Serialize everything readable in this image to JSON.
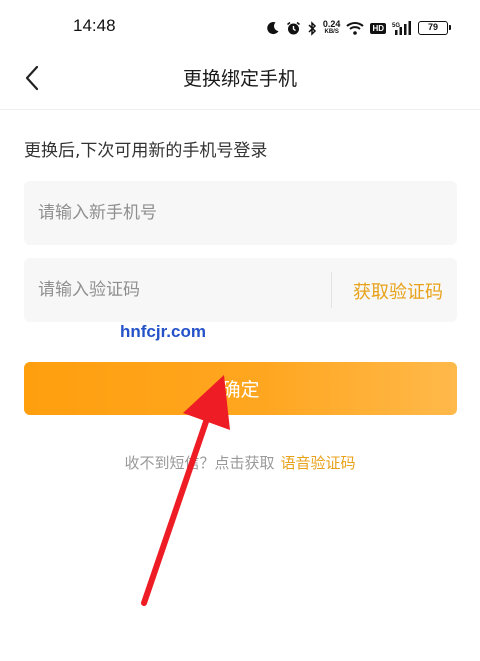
{
  "status_bar": {
    "time": "14:48",
    "net_speed_value": "0.24",
    "net_speed_unit": "KB/S",
    "hd_label": "HD",
    "signal_label": "5G",
    "battery_level": "79"
  },
  "nav": {
    "title": "更换绑定手机"
  },
  "hint": "更换后,下次可用新的手机号登录",
  "phone_input": {
    "placeholder": "请输入新手机号",
    "value": ""
  },
  "code_input": {
    "placeholder": "请输入验证码",
    "value": "",
    "get_code_label": "获取验证码"
  },
  "watermark": "hnfcjr.com",
  "confirm_button": {
    "label": "确定"
  },
  "footer": {
    "prompt": "收不到短信？点击获取",
    "voice_code_link": "语音验证码"
  },
  "colors": {
    "accent": "#e8a21a",
    "button_gradient_start": "#ff9f0e",
    "button_gradient_end": "#ffb94a",
    "annotation_arrow": "#ee1c24",
    "watermark": "#2452c8"
  },
  "icons": {
    "back": "chevron-left-icon",
    "status": [
      "moon-icon",
      "alarm-icon",
      "bluetooth-icon",
      "wifi-icon",
      "signal-icon",
      "battery-icon"
    ]
  }
}
